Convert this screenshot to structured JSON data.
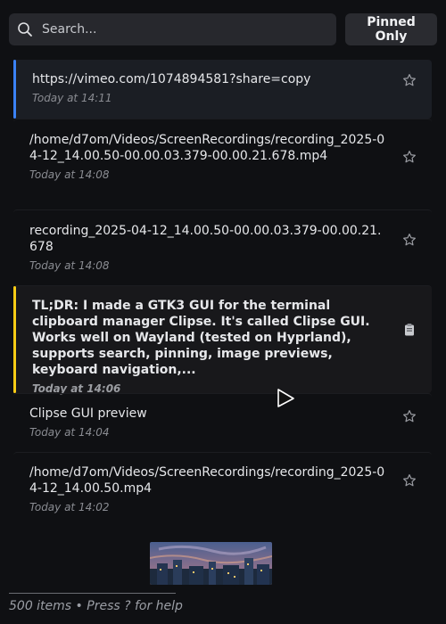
{
  "search": {
    "placeholder": "Search...",
    "value": ""
  },
  "toolbar": {
    "pinned_only_label": "Pinned Only"
  },
  "items": [
    {
      "title": "https://vimeo.com/1074894581?share=copy",
      "time": "Today at 14:11",
      "icon": "star-icon"
    },
    {
      "title": "/home/d7om/Videos/ScreenRecordings/recording_2025-04-12_14.00.50-00.00.03.379-00.00.21.678.mp4",
      "time": "Today at 14:08",
      "icon": "star-icon"
    },
    {
      "title": "recording_2025-04-12_14.00.50-00.00.03.379-00.00.21.678",
      "time": "Today at 14:08",
      "icon": "star-icon"
    },
    {
      "title": "TL;DR: I made a GTK3 GUI for the terminal clipboard manager Clipse. It's called Clipse GUI. Works well on Wayland (tested on Hyprland), supports search, pinning, image previews, keyboard navigation,...",
      "time": "Today at 14:06",
      "icon": "pin-badge-icon"
    },
    {
      "title": "Clipse GUI preview",
      "time": "Today at 14:04",
      "icon": "star-icon"
    },
    {
      "title": "/home/d7om/Videos/ScreenRecordings/recording_2025-04-12_14.00.50.mp4",
      "time": "Today at 14:02",
      "icon": "star-icon"
    }
  ],
  "footer": {
    "status": "500 items • Press ? for help"
  },
  "colors": {
    "background": "#0f1013",
    "selected_accent": "#3b82f6",
    "highlight_accent": "#facc15",
    "text": "#e6e7ea",
    "muted": "#8a8c92"
  }
}
